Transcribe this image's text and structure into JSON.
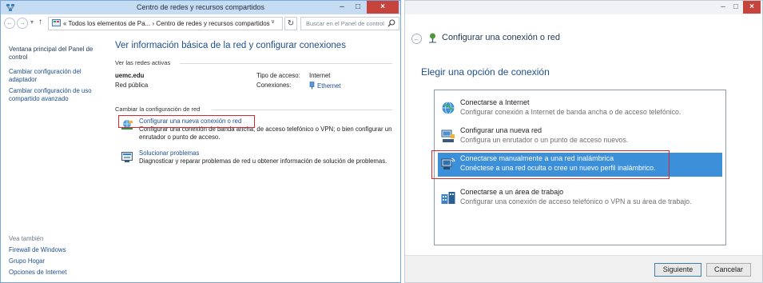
{
  "colors": {
    "link": "#1f4f8a",
    "highlight_box": "#d9272e",
    "selection": "#3c8fd9",
    "close_button": "#c7443c"
  },
  "left_window": {
    "title": "Centro de redes y recursos compartidos",
    "controls": {
      "minimize": "–",
      "maximize": "□",
      "close": "×"
    },
    "address_bar": {
      "back_icon": "arrow-left-icon",
      "forward_icon": "arrow-right-icon",
      "up_icon": "arrow-up-icon",
      "path": "« Todos los elementos de Pa... › Centro de redes y recursos compartidos",
      "refresh_icon": "refresh-icon",
      "search_placeholder": "Buscar en el Panel de control"
    },
    "sidebar": {
      "home": "Ventana principal del Panel de control",
      "links": [
        "Cambiar configuración del adaptador",
        "Cambiar configuración de uso compartido avanzado"
      ],
      "see_also_title": "Vea también",
      "see_also": [
        "Firewall de Windows",
        "Grupo Hogar",
        "Opciones de Internet"
      ]
    },
    "main": {
      "title": "Ver información básica de la red y configurar conexiones",
      "active_networks_label": "Ver las redes activas",
      "network": {
        "name": "uemc.edu",
        "type": "Red pública",
        "access_type_label": "Tipo de acceso:",
        "access_type_value": "Internet",
        "connections_label": "Conexiones:",
        "connections_value": "Ethernet"
      },
      "change_settings_label": "Cambiar la configuración de red",
      "tasks": [
        {
          "icon": "network-setup-icon",
          "link": "Configurar una nueva conexión o red",
          "desc": "Configurar una conexión de banda ancha, de acceso telefónico o VPN; o bien configurar un enrutador o punto de acceso."
        },
        {
          "icon": "troubleshoot-icon",
          "link": "Solucionar problemas",
          "desc": "Diagnosticar y reparar problemas de red u obtener información de solución de problemas."
        }
      ]
    }
  },
  "right_window": {
    "controls": {
      "minimize": "–",
      "maximize": "□",
      "close": "×"
    },
    "title": "Configurar una conexión o red",
    "heading": "Elegir una opción de conexión",
    "options": [
      {
        "icon": "globe-icon",
        "title": "Conectarse a Internet",
        "desc": "Configurar conexión a Internet de banda ancha o de acceso telefónico.",
        "selected": false
      },
      {
        "icon": "router-icon",
        "title": "Configurar una nueva red",
        "desc": "Configura un enrutador o un punto de acceso nuevos.",
        "selected": false
      },
      {
        "icon": "wireless-icon",
        "title": "Conectarse manualmente a una red inalámbrica",
        "desc": "Conéctese a una red oculta o cree un nuevo perfil inalámbrico.",
        "selected": true
      },
      {
        "icon": "workplace-icon",
        "title": "Conectarse a un área de trabajo",
        "desc": "Configurar una conexión de acceso telefónico o VPN a su área de trabajo.",
        "selected": false
      }
    ],
    "buttons": {
      "next": "Siguiente",
      "cancel": "Cancelar"
    }
  }
}
